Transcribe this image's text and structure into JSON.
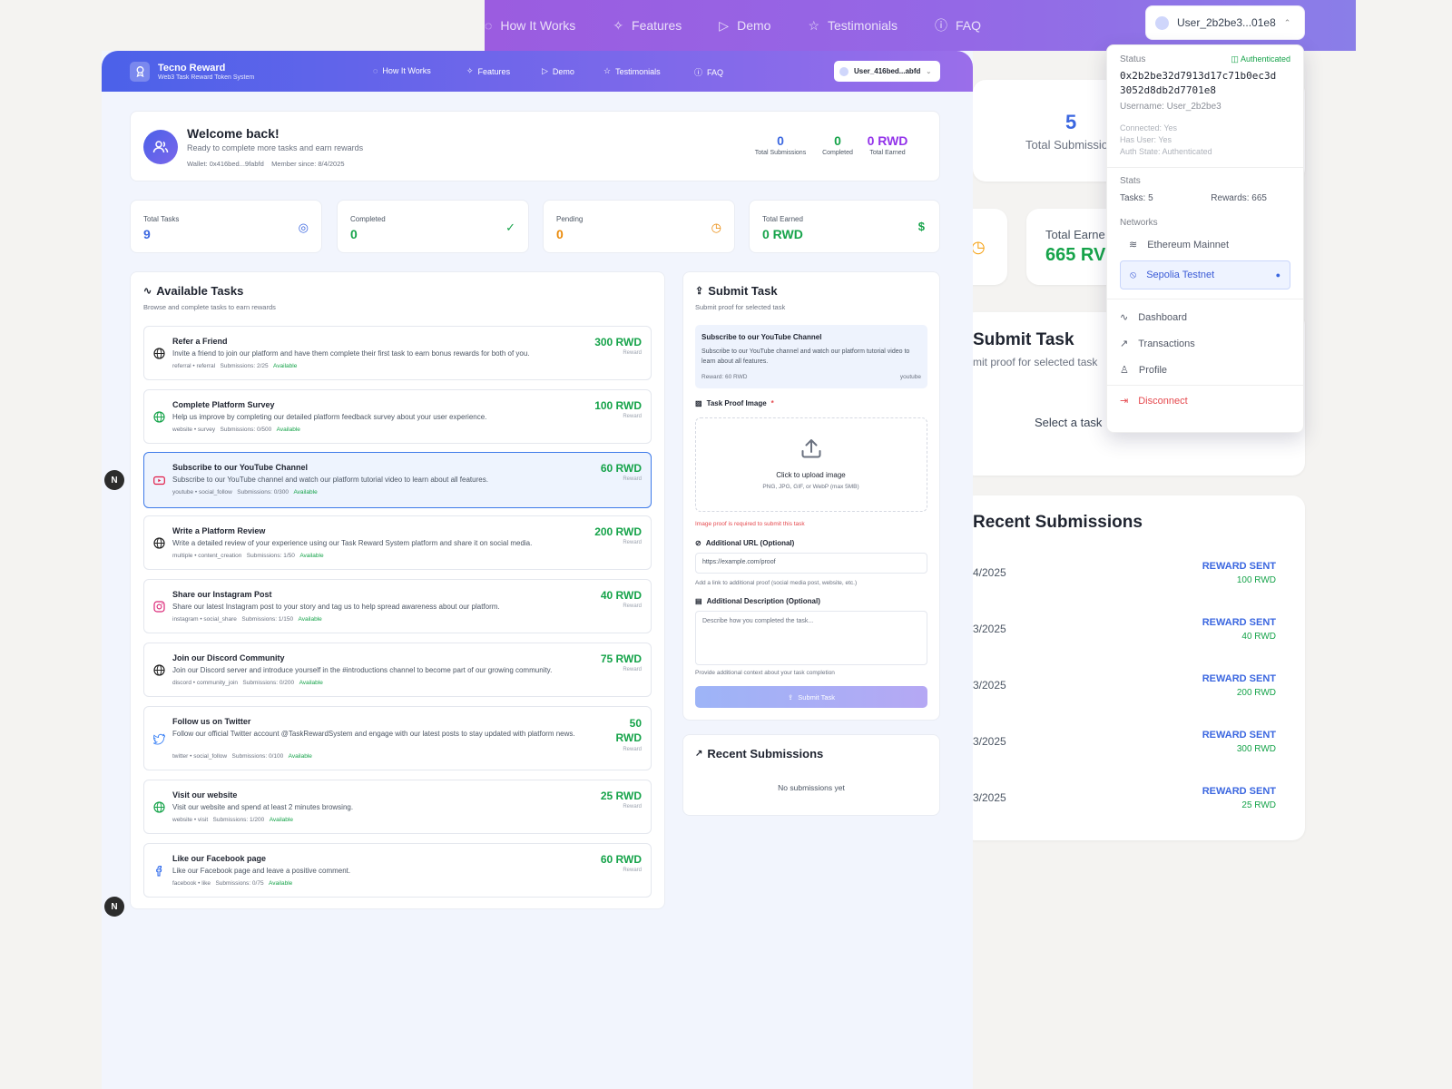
{
  "back": {
    "nav": [
      "How It Works",
      "Features",
      "Demo",
      "Testimonials",
      "FAQ"
    ],
    "user": "User_2b2be3...01e8",
    "stat_value": "5",
    "stat_label": "Total Submissio",
    "earned_label": "Total Earne",
    "earned_value": "665 RV",
    "submit_title": "Submit Task",
    "submit_sub": "mit proof for selected task",
    "select_text": "Select a task",
    "recent_title": "Recent Submissions",
    "recent": [
      {
        "date": "4/2025",
        "status": "REWARD SENT",
        "amount": "100 RWD"
      },
      {
        "date": "3/2025",
        "status": "REWARD SENT",
        "amount": "40 RWD"
      },
      {
        "date": "3/2025",
        "status": "REWARD SENT",
        "amount": "200 RWD"
      },
      {
        "date": "3/2025",
        "status": "REWARD SENT",
        "amount": "300 RWD"
      },
      {
        "date": "3/2025",
        "status": "REWARD SENT",
        "amount": "25 RWD"
      }
    ]
  },
  "dropdown": {
    "status_label": "Status",
    "auth_badge": "Authenticated",
    "address_line1": "0x2b2be32d7913d17c71b0ec3d",
    "address_line2": "3052d8db2d7701e8",
    "username": "Username: User_2b2be3",
    "connected": "Connected: Yes",
    "has_user": "Has User: Yes",
    "auth_state": "Auth State: Authenticated",
    "stats_label": "Stats",
    "tasks": "Tasks: 5",
    "rewards": "Rewards: 665",
    "networks_label": "Networks",
    "net1": "Ethereum Mainnet",
    "net2": "Sepolia Testnet",
    "menu": [
      "Dashboard",
      "Transactions",
      "Profile"
    ],
    "disconnect": "Disconnect"
  },
  "front": {
    "brand_title": "Tecno Reward",
    "brand_sub": "Web3 Task Reward Token System",
    "nav": [
      "How It Works",
      "Features",
      "Demo",
      "Testimonials",
      "FAQ"
    ],
    "user": "User_416bed...abfd",
    "welcome": {
      "title": "Welcome back!",
      "subtitle": "Ready to complete more tasks and earn rewards",
      "meta": "Wallet: 0x416bed...9fabfd    Member since: 8/4/2025",
      "s1_val": "0",
      "s1_lbl": "Total Submissions",
      "s2_val": "0",
      "s2_lbl": "Completed",
      "s3_val": "0 RWD",
      "s3_lbl": "Total Earned"
    },
    "stats": [
      {
        "label": "Total Tasks",
        "value": "9"
      },
      {
        "label": "Completed",
        "value": "0"
      },
      {
        "label": "Pending",
        "value": "0"
      },
      {
        "label": "Total Earned",
        "value": "0 RWD"
      }
    ],
    "tasks_title": "Available Tasks",
    "tasks_sub": "Browse and complete tasks to earn rewards",
    "reward_label": "Reward",
    "tasks": [
      {
        "title": "Refer a Friend",
        "desc": "Invite a friend to join our platform and have them complete their first task to earn bonus rewards for both of you.",
        "tags": "referral • referral",
        "subs": "Submissions: 2/25",
        "avail": "Available",
        "reward": "300 RWD"
      },
      {
        "title": "Complete Platform Survey",
        "desc": "Help us improve by completing our detailed platform feedback survey about your user experience.",
        "tags": "website • survey",
        "subs": "Submissions: 0/500",
        "avail": "Available",
        "reward": "100 RWD"
      },
      {
        "title": "Subscribe to our YouTube Channel",
        "desc": "Subscribe to our YouTube channel and watch our platform tutorial video to learn about all features.",
        "tags": "youtube • social_follow",
        "subs": "Submissions: 0/300",
        "avail": "Available",
        "reward": "60 RWD"
      },
      {
        "title": "Write a Platform Review",
        "desc": "Write a detailed review of your experience using our Task Reward System platform and share it on social media.",
        "tags": "multiple • content_creation",
        "subs": "Submissions: 1/50",
        "avail": "Available",
        "reward": "200 RWD"
      },
      {
        "title": "Share our Instagram Post",
        "desc": "Share our latest Instagram post to your story and tag us to help spread awareness about our platform.",
        "tags": "instagram • social_share",
        "subs": "Submissions: 1/150",
        "avail": "Available",
        "reward": "40 RWD"
      },
      {
        "title": "Join our Discord Community",
        "desc": "Join our Discord server and introduce yourself in the #introductions channel to become part of our growing community.",
        "tags": "discord • community_join",
        "subs": "Submissions: 0/200",
        "avail": "Available",
        "reward": "75 RWD"
      },
      {
        "title": "Follow us on Twitter",
        "desc": "Follow our official Twitter account @TaskRewardSystem and engage with our latest posts to stay updated with platform news.",
        "tags": "twitter • social_follow",
        "subs": "Submissions: 0/100",
        "avail": "Available",
        "reward": "50 RWD"
      },
      {
        "title": "Visit our website",
        "desc": "Visit our website and spend at least 2 minutes browsing.",
        "tags": "website • visit",
        "subs": "Submissions: 1/200",
        "avail": "Available",
        "reward": "25 RWD"
      },
      {
        "title": "Like our Facebook page",
        "desc": "Like our Facebook page and leave a positive comment.",
        "tags": "facebook • like",
        "subs": "Submissions: 0/75",
        "avail": "Available",
        "reward": "60 RWD"
      }
    ],
    "submit": {
      "title": "Submit Task",
      "sub": "Submit proof for selected task",
      "sel_title": "Subscribe to our YouTube Channel",
      "sel_desc": "Subscribe to our YouTube channel and watch our platform tutorial video to learn about all features.",
      "sel_reward": "Reward: 60 RWD",
      "sel_platform": "youtube",
      "proof_label": "Task Proof Image",
      "upload_text": "Click to upload image",
      "upload_hint": "PNG, JPG, GIF, or WebP (max 5MB)",
      "error": "Image proof is required to submit this task",
      "url_label": "Additional URL (Optional)",
      "url_placeholder": "https://example.com/proof",
      "url_hint": "Add a link to additional proof (social media post, website, etc.)",
      "desc_label": "Additional Description (Optional)",
      "desc_placeholder": "Describe how you completed the task...",
      "desc_hint": "Provide additional context about your task completion",
      "button": "Submit Task"
    },
    "recent_title": "Recent Submissions",
    "recent_empty": "No submissions yet"
  }
}
